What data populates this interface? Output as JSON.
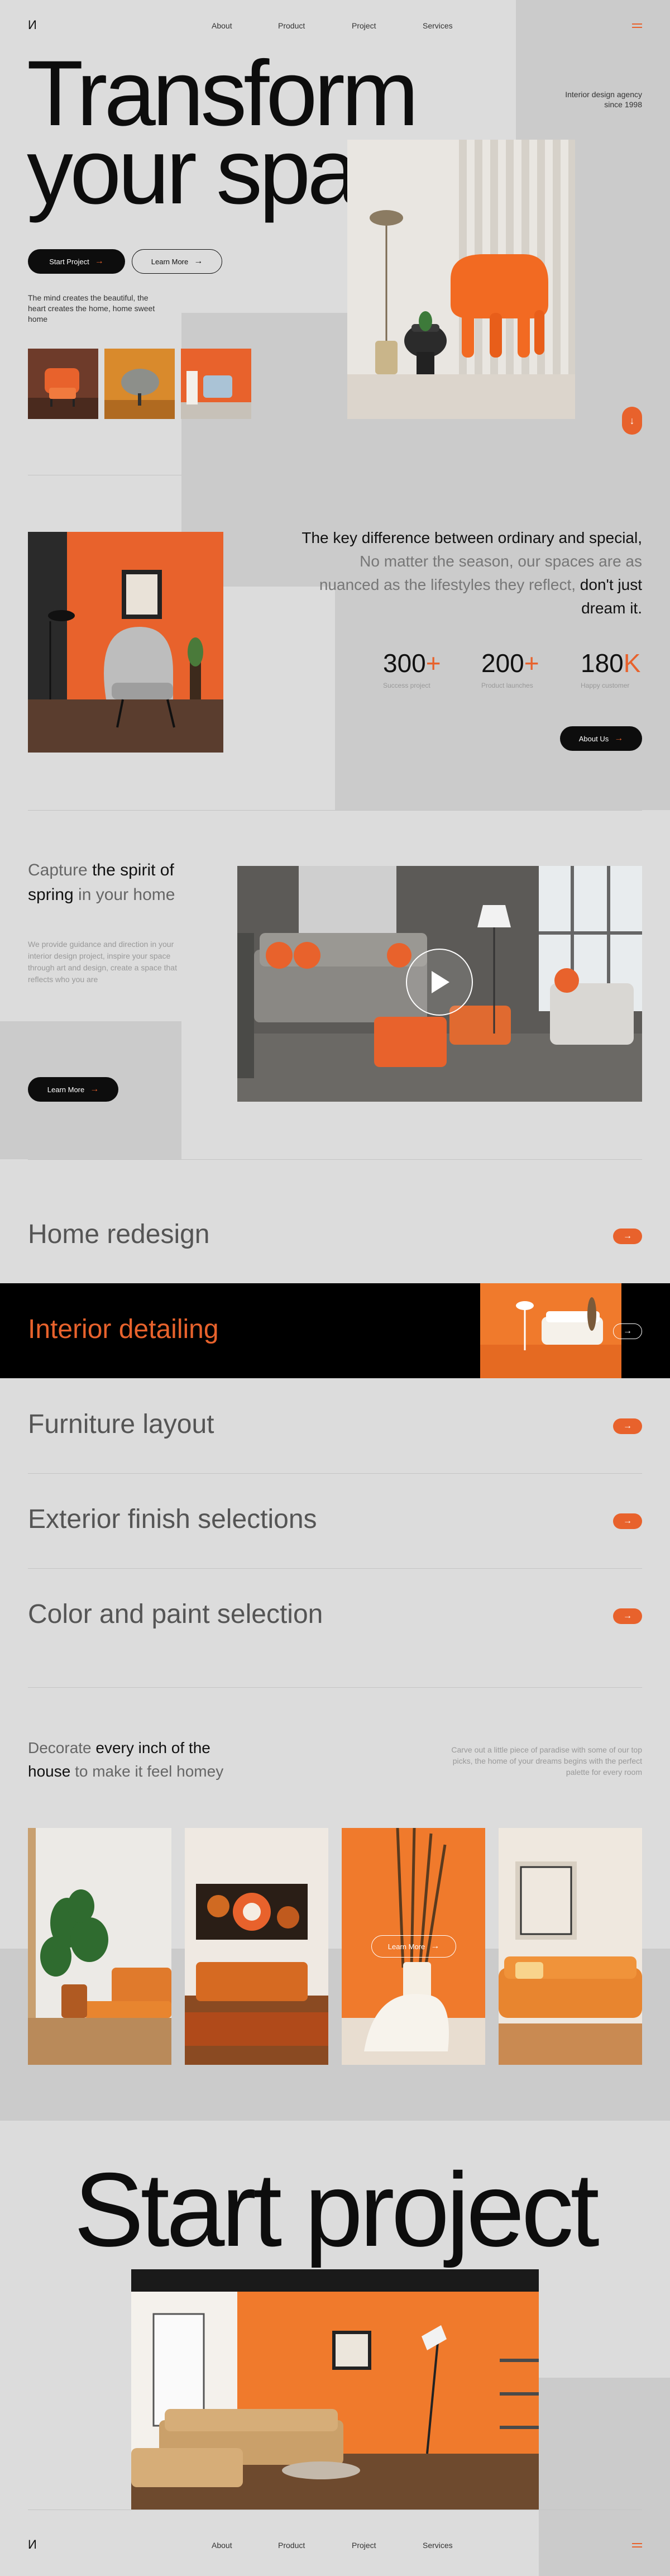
{
  "colors": {
    "accent": "#e8622c",
    "background": "#dcdcdc",
    "panel": "#cbcbcb",
    "dark": "#0d0d0d"
  },
  "nav": {
    "logo": "И",
    "links": [
      "About",
      "Product",
      "Project",
      "Services"
    ],
    "menu_icon": "hamburger-menu-icon"
  },
  "hero": {
    "title_line1": "Transform",
    "title_line2": "your space",
    "tagline_line1": "Interior design agency",
    "tagline_line2": "since 1998",
    "start_button": "Start Project",
    "learn_button": "Learn More",
    "description": "The mind creates the beautiful, the heart creates the home, home sweet home",
    "scroll_icon": "arrow-down-icon"
  },
  "about": {
    "text_dark": "The key difference between ordinary and special,",
    "text_light": " No matter the season, our spaces are as nuanced as the lifestyles they reflect,",
    "text_end": " don't just dream it.",
    "stats": [
      {
        "value": "300",
        "suffix": "+",
        "caption": "Success project"
      },
      {
        "value": "200",
        "suffix": "+",
        "caption": "Product launches"
      },
      {
        "value": "180",
        "suffix": "K",
        "caption": "Happy customer"
      }
    ],
    "button": "About Us"
  },
  "spring": {
    "title_light1": "Capture",
    "title_dark1": " the spirit of",
    "title_dark2": "spring",
    "title_light2": " in your home",
    "description": "We provide guidance and direction in your interior design project, inspire your space through art and design, create a space that reflects who you are",
    "button": "Learn More",
    "play_icon": "play-icon"
  },
  "services": [
    {
      "label": "Home redesign"
    },
    {
      "label": "Interior detailing"
    },
    {
      "label": "Furniture layout"
    },
    {
      "label": "Exterior finish selections"
    },
    {
      "label": "Color and paint selection"
    }
  ],
  "decorate": {
    "title_light1": "Decorate",
    "title_dark1": " every inch of the",
    "title_dark2": "house",
    "title_light2": " to make it feel homey",
    "description": "Carve out a little piece of paradise with some of our top picks, the home of your dreams begins with the perfect palette for every room",
    "gallery_button": "Learn More"
  },
  "cta": {
    "title": "Start project"
  },
  "footer": {
    "logo": "И",
    "links": [
      "About",
      "Product",
      "Project",
      "Services"
    ]
  }
}
